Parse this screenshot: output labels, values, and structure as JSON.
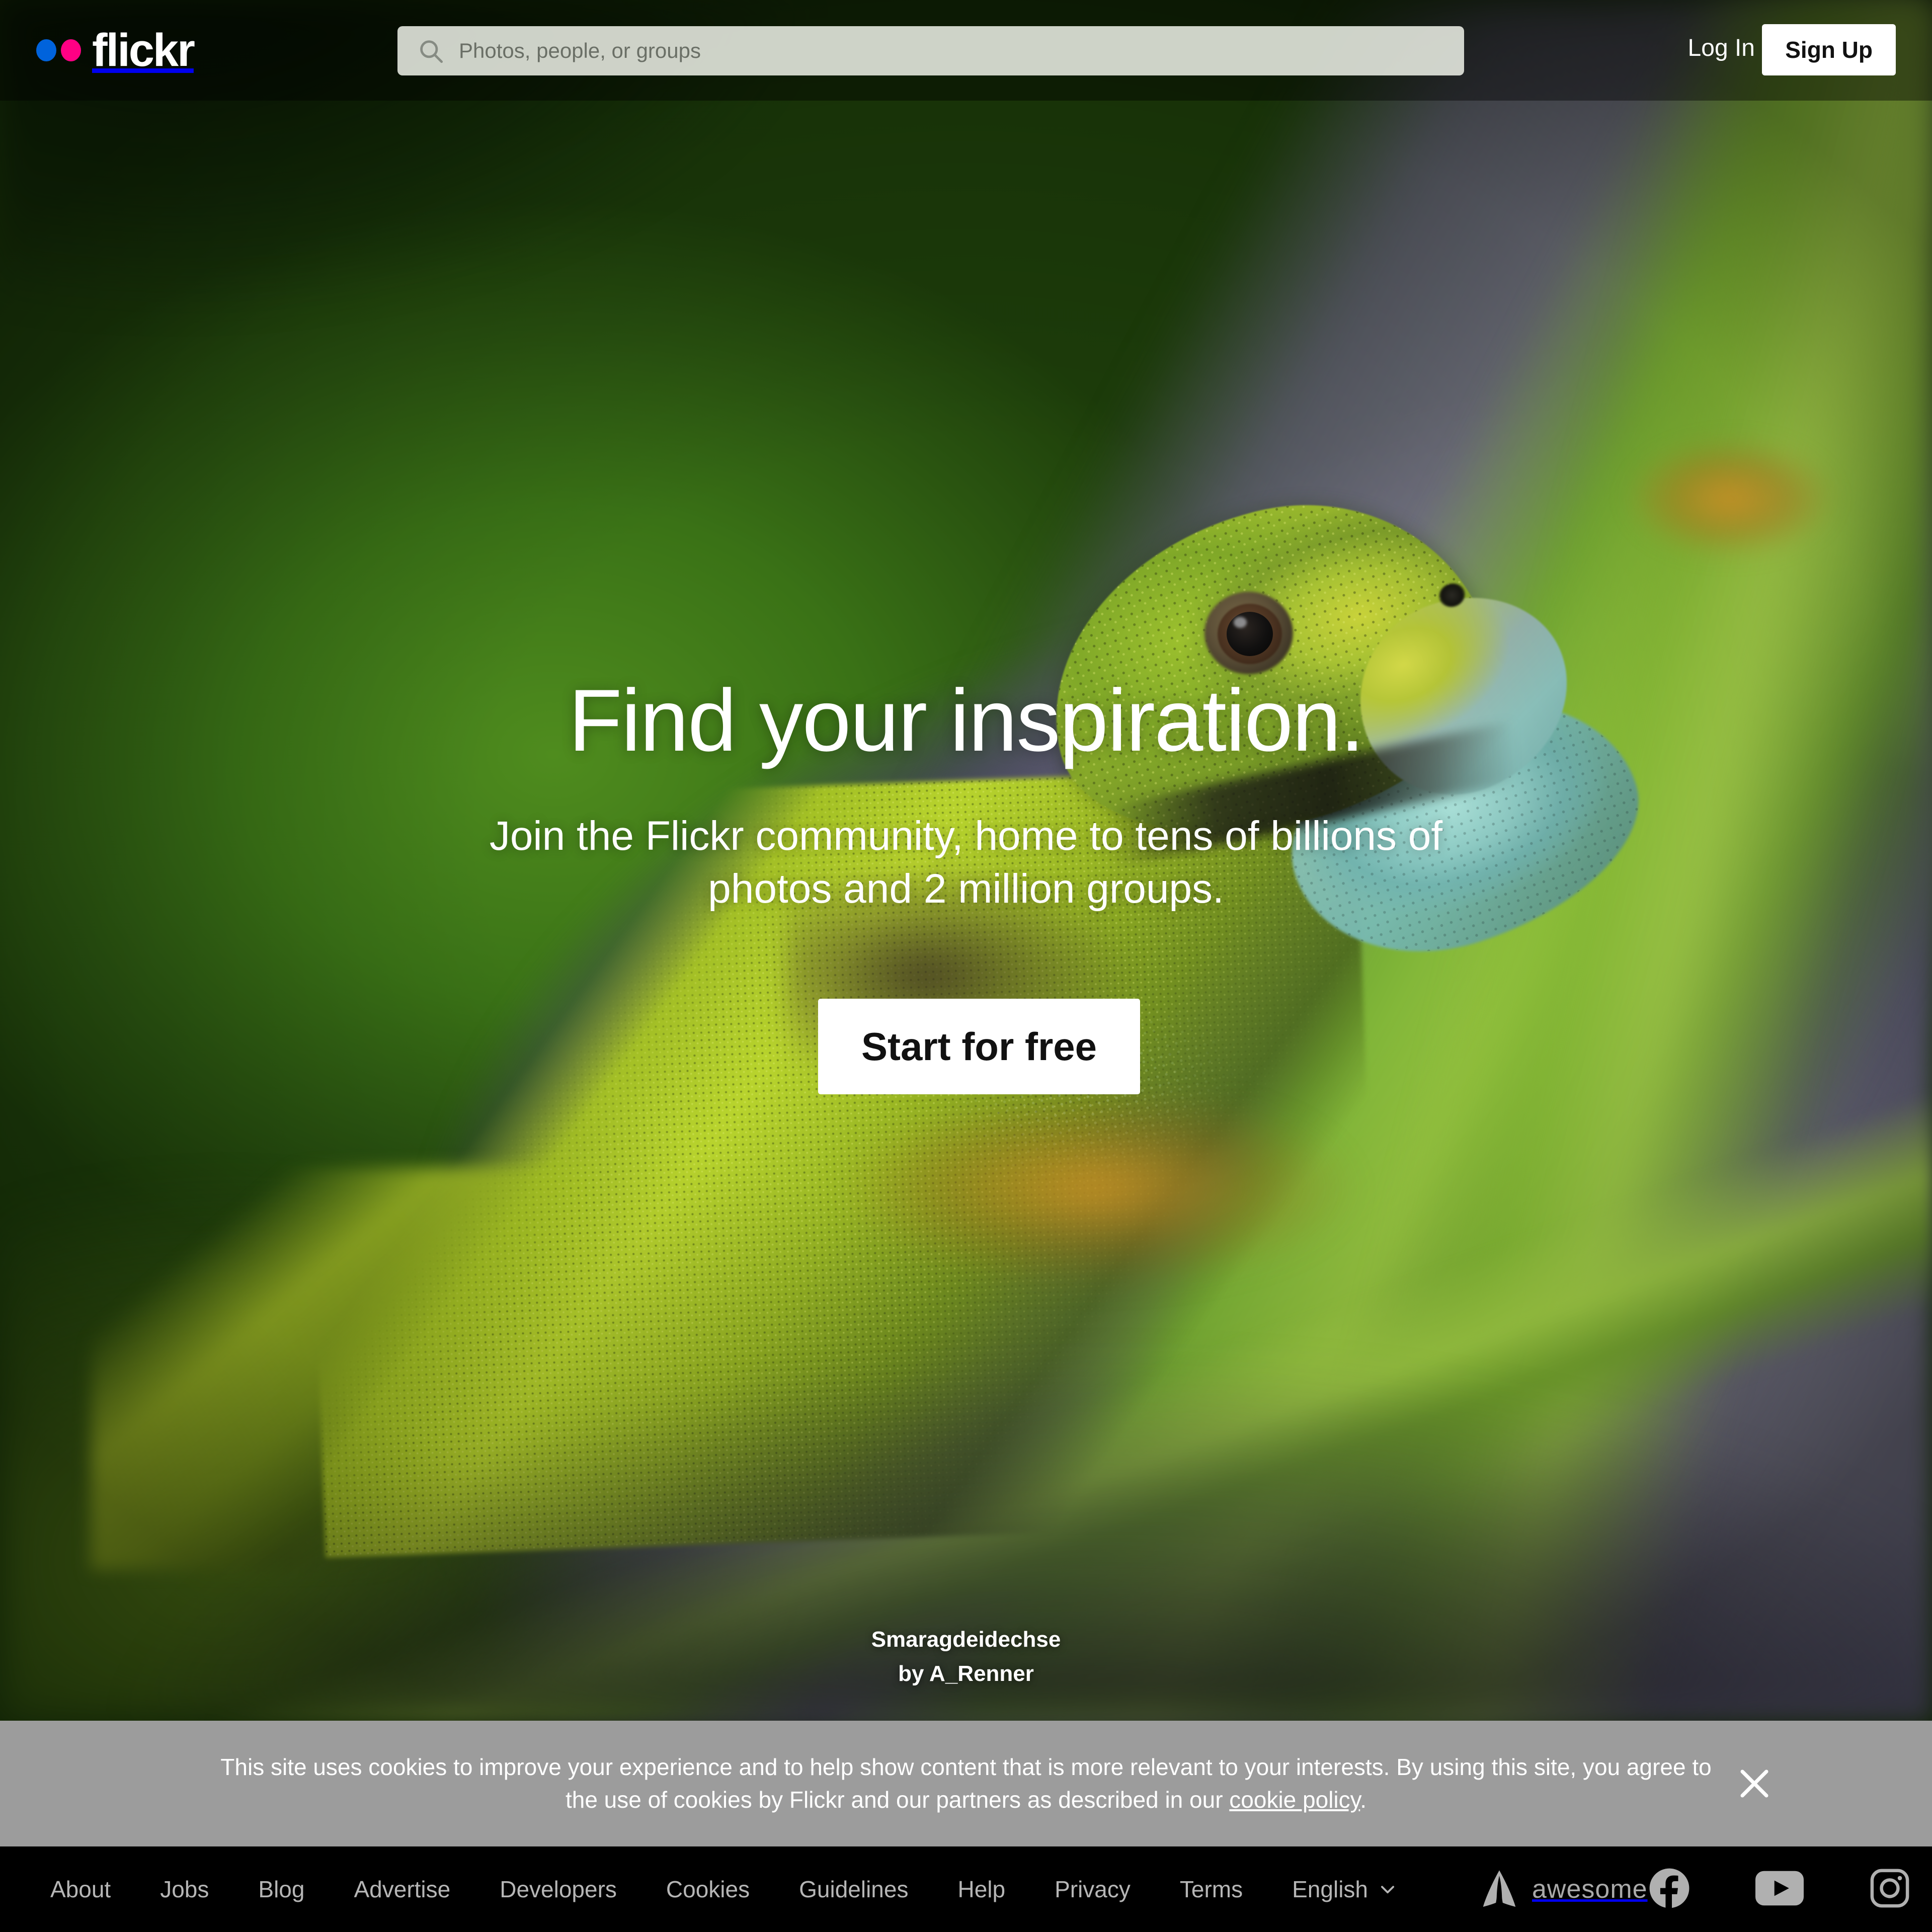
{
  "header": {
    "logo_text": "flickr",
    "logo_dot_blue": "#0063dc",
    "logo_dot_pink": "#ff0084",
    "search_placeholder": "Photos, people, or groups",
    "search_value": "",
    "search_icon": "search-icon",
    "login_label": "Log In",
    "signup_label": "Sign Up"
  },
  "hero": {
    "headline": "Find your inspiration.",
    "subhead": "Join the Flickr community, home to tens of billions of photos and 2 million groups.",
    "cta_label": "Start for free",
    "photo_title": "Smaragdeidechse",
    "photo_author": "by A_Renner"
  },
  "cookie": {
    "text_before": "This site uses cookies to improve your experience and to help show content that is more relevant to your interests. By using this site, you agree to the use of cookies by Flickr and our partners as described in our ",
    "link_label": "cookie policy",
    "text_after": ".",
    "close_icon": "close-icon",
    "background": "#9c9c9c"
  },
  "footer": {
    "links": [
      {
        "label": "About"
      },
      {
        "label": "Jobs"
      },
      {
        "label": "Blog"
      },
      {
        "label": "Advertise"
      },
      {
        "label": "Developers"
      },
      {
        "label": "Cookies"
      },
      {
        "label": "Guidelines"
      },
      {
        "label": "Help"
      },
      {
        "label": "Privacy"
      },
      {
        "label": "Terms"
      }
    ],
    "language": "English",
    "language_icon": "chevron-down-icon",
    "brand_word": "awesome",
    "brand_icon": "smugmug-a-icon",
    "social": [
      {
        "name": "facebook-icon"
      },
      {
        "name": "youtube-icon"
      },
      {
        "name": "instagram-icon"
      }
    ],
    "background": "#000000",
    "link_color": "#b6b6b6"
  }
}
